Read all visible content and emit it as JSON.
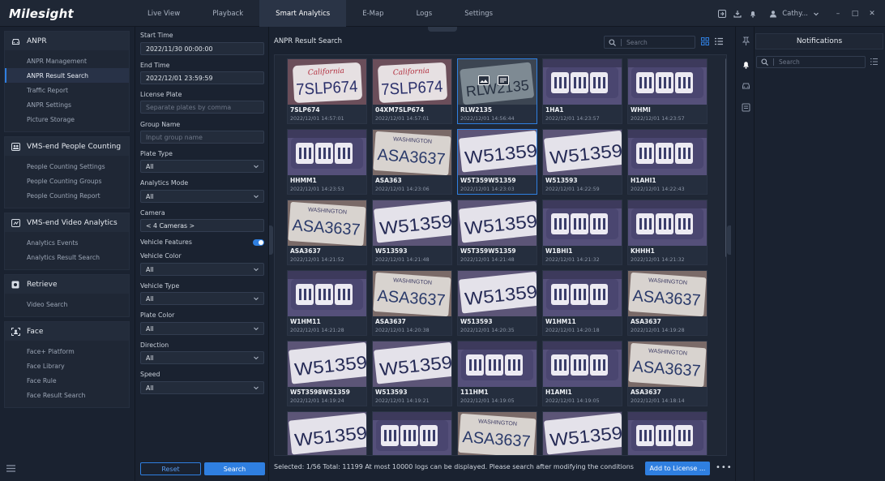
{
  "app": {
    "logo": "Milesight"
  },
  "nav": {
    "tabs": [
      {
        "label": "Live View",
        "active": false
      },
      {
        "label": "Playback",
        "active": false
      },
      {
        "label": "Smart Analytics",
        "active": true
      },
      {
        "label": "E-Map",
        "active": false
      },
      {
        "label": "Logs",
        "active": false
      },
      {
        "label": "Settings",
        "active": false
      }
    ]
  },
  "topbar": {
    "user": "Cathy...",
    "icons": [
      "export-icon",
      "download-icon",
      "bell-icon",
      "user-icon"
    ]
  },
  "sidebar": {
    "groups": [
      {
        "title": "ANPR",
        "icon": "car-icon",
        "items": [
          {
            "label": "ANPR Management",
            "active": false
          },
          {
            "label": "ANPR Result Search",
            "active": true
          },
          {
            "label": "Traffic Report",
            "active": false
          },
          {
            "label": "ANPR Settings",
            "active": false
          },
          {
            "label": "Picture Storage",
            "active": false
          }
        ]
      },
      {
        "title": "VMS-end People Counting",
        "icon": "people-icon",
        "items": [
          {
            "label": "People Counting Settings",
            "active": false
          },
          {
            "label": "People Counting Groups",
            "active": false
          },
          {
            "label": "People Counting Report",
            "active": false
          }
        ]
      },
      {
        "title": "VMS-end Video Analytics",
        "icon": "analytics-icon",
        "items": [
          {
            "label": "Analytics Events",
            "active": false
          },
          {
            "label": "Analytics Result Search",
            "active": false
          }
        ]
      },
      {
        "title": "Retrieve",
        "icon": "search-icon",
        "items": [
          {
            "label": "Video Search",
            "active": false
          }
        ]
      },
      {
        "title": "Face",
        "icon": "face-icon",
        "items": [
          {
            "label": "Face+ Platform",
            "active": false
          },
          {
            "label": "Face Library",
            "active": false
          },
          {
            "label": "Face Rule",
            "active": false
          },
          {
            "label": "Face Result Search",
            "active": false
          }
        ]
      }
    ]
  },
  "filters": {
    "start_time": {
      "label": "Start Time",
      "value": "2022/11/30 00:00:00"
    },
    "end_time": {
      "label": "End Time",
      "value": "2022/12/01 23:59:59"
    },
    "license_plate": {
      "label": "License Plate",
      "placeholder": "Separate plates by comma"
    },
    "group_name": {
      "label": "Group Name",
      "placeholder": "Input group name"
    },
    "plate_type": {
      "label": "Plate Type",
      "value": "All"
    },
    "analytics_mode": {
      "label": "Analytics Mode",
      "value": "All"
    },
    "camera": {
      "label": "Camera",
      "value": "< 4 Cameras >"
    },
    "vehicle_features": {
      "label": "Vehicle Features",
      "enabled": true
    },
    "vehicle_color": {
      "label": "Vehicle Color",
      "value": "All"
    },
    "vehicle_type": {
      "label": "Vehicle Type",
      "value": "All"
    },
    "plate_color": {
      "label": "Plate Color",
      "value": "All"
    },
    "direction": {
      "label": "Direction",
      "value": "All"
    },
    "speed": {
      "label": "Speed",
      "value": "All"
    },
    "reset_label": "Reset",
    "search_label": "Search"
  },
  "results": {
    "title": "ANPR Result Search",
    "search_placeholder": "Search",
    "footer": "Selected: 1/56  Total: 11199  At most 10000 logs can be displayed. Please search after modifying the conditions",
    "add_label": "Add to License ...",
    "more": "•••",
    "items": [
      {
        "plate": "7SLP674",
        "time": "2022/12/01 14:57:01",
        "img": "cal7",
        "selected": false
      },
      {
        "plate": "04XM7SLP674",
        "time": "2022/12/01 14:57:01",
        "img": "cal7",
        "selected": false
      },
      {
        "plate": "RLW2135",
        "time": "2022/12/01 14:56:44",
        "img": "dark",
        "selected": true
      },
      {
        "plate": "1HA1",
        "time": "2022/12/01 14:23:57",
        "img": "multi",
        "selected": false
      },
      {
        "plate": "WHMI",
        "time": "2022/12/01 14:23:57",
        "img": "multi",
        "selected": false
      },
      {
        "plate": "HHMM1",
        "time": "2022/12/01 14:23:53",
        "img": "multi",
        "selected": false
      },
      {
        "plate": "ASA363",
        "time": "2022/12/01 14:23:06",
        "img": "asa",
        "selected": false
      },
      {
        "plate": "W5T359W51359",
        "time": "2022/12/01 14:23:03",
        "img": "w51",
        "selected": true
      },
      {
        "plate": "W513593",
        "time": "2022/12/01 14:22:59",
        "img": "w51",
        "selected": false
      },
      {
        "plate": "H1AHI1",
        "time": "2022/12/01 14:22:43",
        "img": "multi",
        "selected": false
      },
      {
        "plate": "ASA3637",
        "time": "2022/12/01 14:21:52",
        "img": "asa",
        "selected": false
      },
      {
        "plate": "W513593",
        "time": "2022/12/01 14:21:48",
        "img": "w51",
        "selected": false
      },
      {
        "plate": "W5T359W51359",
        "time": "2022/12/01 14:21:48",
        "img": "w51",
        "selected": false
      },
      {
        "plate": "W1BHI1",
        "time": "2022/12/01 14:21:32",
        "img": "multi",
        "selected": false
      },
      {
        "plate": "KHHH1",
        "time": "2022/12/01 14:21:32",
        "img": "multi",
        "selected": false
      },
      {
        "plate": "W1HM11",
        "time": "2022/12/01 14:21:28",
        "img": "multi",
        "selected": false
      },
      {
        "plate": "ASA3637",
        "time": "2022/12/01 14:20:38",
        "img": "asa",
        "selected": false
      },
      {
        "plate": "W513593",
        "time": "2022/12/01 14:20:35",
        "img": "w51",
        "selected": false
      },
      {
        "plate": "W1HM11",
        "time": "2022/12/01 14:20:18",
        "img": "multi",
        "selected": false
      },
      {
        "plate": "ASA3637",
        "time": "2022/12/01 14:19:28",
        "img": "asa",
        "selected": false
      },
      {
        "plate": "W5T3598W51359",
        "time": "2022/12/01 14:19:24",
        "img": "w51",
        "selected": false
      },
      {
        "plate": "W513593",
        "time": "2022/12/01 14:19:21",
        "img": "w51",
        "selected": false
      },
      {
        "plate": "111HM1",
        "time": "2022/12/01 14:19:05",
        "img": "multi",
        "selected": false
      },
      {
        "plate": "H1AMI1",
        "time": "2022/12/01 14:19:05",
        "img": "multi",
        "selected": false
      },
      {
        "plate": "ASA3637",
        "time": "2022/12/01 14:18:14",
        "img": "asa",
        "selected": false
      },
      {
        "plate": "",
        "time": "",
        "img": "w51",
        "selected": false
      },
      {
        "plate": "",
        "time": "",
        "img": "multi",
        "selected": false
      },
      {
        "plate": "",
        "time": "",
        "img": "asa",
        "selected": false
      },
      {
        "plate": "",
        "time": "",
        "img": "w51",
        "selected": false
      },
      {
        "plate": "",
        "time": "",
        "img": "multi",
        "selected": false
      }
    ]
  },
  "image_text": {
    "cal7": {
      "top": "California",
      "main": "7SLP674"
    },
    "asa": {
      "top": "WASHINGTON",
      "main": "ASA3637"
    },
    "w51": {
      "top": "",
      "main": "W51359"
    },
    "dark": {
      "top": "",
      "main": "RLW2135"
    }
  },
  "notifications": {
    "title": "Notifications",
    "search_placeholder": "Search"
  },
  "colors": {
    "accent": "#2f7fe0",
    "bg": "#1a2230",
    "panel": "#1f2735"
  }
}
